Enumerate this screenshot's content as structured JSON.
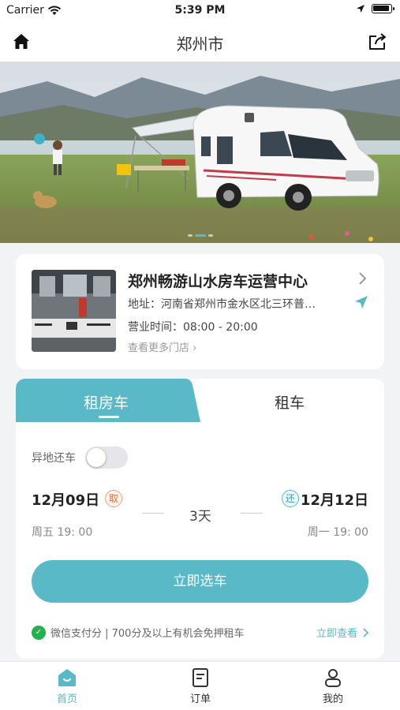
{
  "status_bar": {
    "carrier": "Carrier",
    "time": "5:39 PM"
  },
  "navbar": {
    "title": "郑州市",
    "home_icon": "home-icon",
    "share_icon": "share-icon"
  },
  "banner": {
    "slides": 3,
    "active_slide": 1
  },
  "store": {
    "name": "郑州畅游山水房车运营中心",
    "address": "地址：河南省郑州市金水区北三环普…",
    "hours": "营业时间：08:00 - 20:00",
    "more_link": "查看更多门店 ›"
  },
  "booking": {
    "tabs": [
      {
        "label": "租房车",
        "active": true
      },
      {
        "label": "租车",
        "active": false
      }
    ],
    "toggle_label": "异地还车",
    "toggle_on": false,
    "pickup": {
      "date": "12月09日",
      "badge": "取",
      "time": "周五 19: 00"
    },
    "return": {
      "date": "12月12日",
      "badge": "还",
      "time": "周一 19: 00"
    },
    "duration": "3天",
    "cta": "立即选车",
    "promo_text": "微信支付分 | 700分及以上有机会免押租车",
    "promo_link": "立即查看"
  },
  "tabbar": {
    "items": [
      {
        "label": "首页",
        "icon": "home-icon",
        "active": true
      },
      {
        "label": "订单",
        "icon": "order-icon",
        "active": false
      },
      {
        "label": "我的",
        "icon": "profile-icon",
        "active": false
      }
    ]
  },
  "colors": {
    "accent": "#5ab9c7",
    "pick_badge": "#e06d3b"
  }
}
